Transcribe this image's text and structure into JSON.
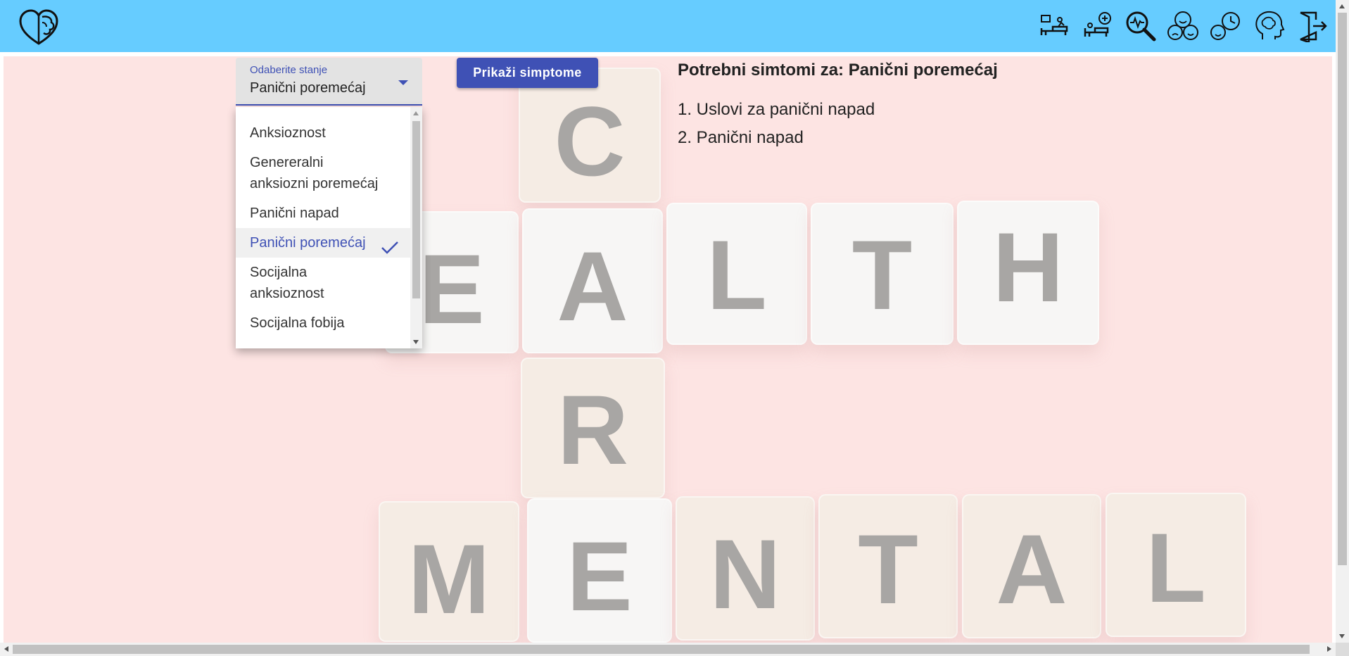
{
  "navbar": {
    "logo_icon": "brain-heart-icon",
    "icons": [
      {
        "name": "therapy-couch-icon"
      },
      {
        "name": "add-patient-icon"
      },
      {
        "name": "diagnosis-search-icon"
      },
      {
        "name": "mood-faces-icon"
      },
      {
        "name": "history-icon"
      },
      {
        "name": "mental-head-icon"
      },
      {
        "name": "logout-icon"
      }
    ]
  },
  "background_image": {
    "letters": [
      "C",
      "E",
      "A",
      "L",
      "T",
      "H",
      "R",
      "M",
      "E",
      "N",
      "T",
      "A",
      "L"
    ]
  },
  "condition_select": {
    "label": "Odaberite stanje",
    "value": "Panični poremećaj",
    "options": [
      "Anksioznost",
      "Genereralni anksiozni poremećaj",
      "Panični napad",
      "Panični poremećaj",
      "Socijalna anksioznost",
      "Socijalna fobija"
    ],
    "selected_index": 3
  },
  "show_button": {
    "label": "Prikaži simptome"
  },
  "symptoms": {
    "title": "Potrebni simtomi za: Panični poremećaj",
    "items": [
      "1. Uslovi za panični napad",
      "2. Panični napad"
    ]
  },
  "colors": {
    "topbar": "#66ccff",
    "accent": "#3f51b5",
    "background": "#fde4e3"
  }
}
